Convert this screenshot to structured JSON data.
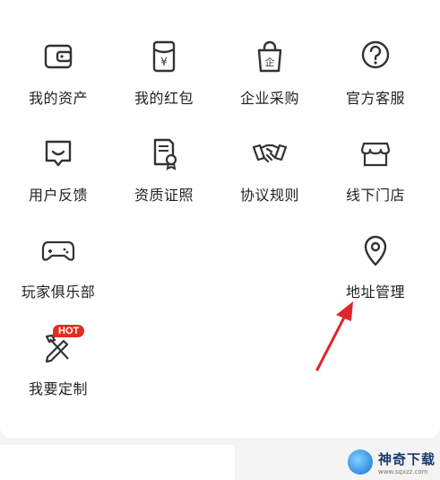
{
  "menu": {
    "items": [
      {
        "label": "我的资产"
      },
      {
        "label": "我的红包"
      },
      {
        "label": "企业采购"
      },
      {
        "label": "官方客服"
      },
      {
        "label": "用户反馈"
      },
      {
        "label": "资质证照"
      },
      {
        "label": "协议规则"
      },
      {
        "label": "线下门店"
      },
      {
        "label": "玩家俱乐部"
      },
      {
        "label": "地址管理"
      },
      {
        "label": "我要定制"
      }
    ],
    "badge_hot": "HOT"
  },
  "watermark": {
    "title": "神奇下载",
    "url": "www.sqxzz.com"
  },
  "colors": {
    "icon_stroke": "#333333",
    "badge": "#e02e24",
    "arrow": "#e0262b"
  }
}
